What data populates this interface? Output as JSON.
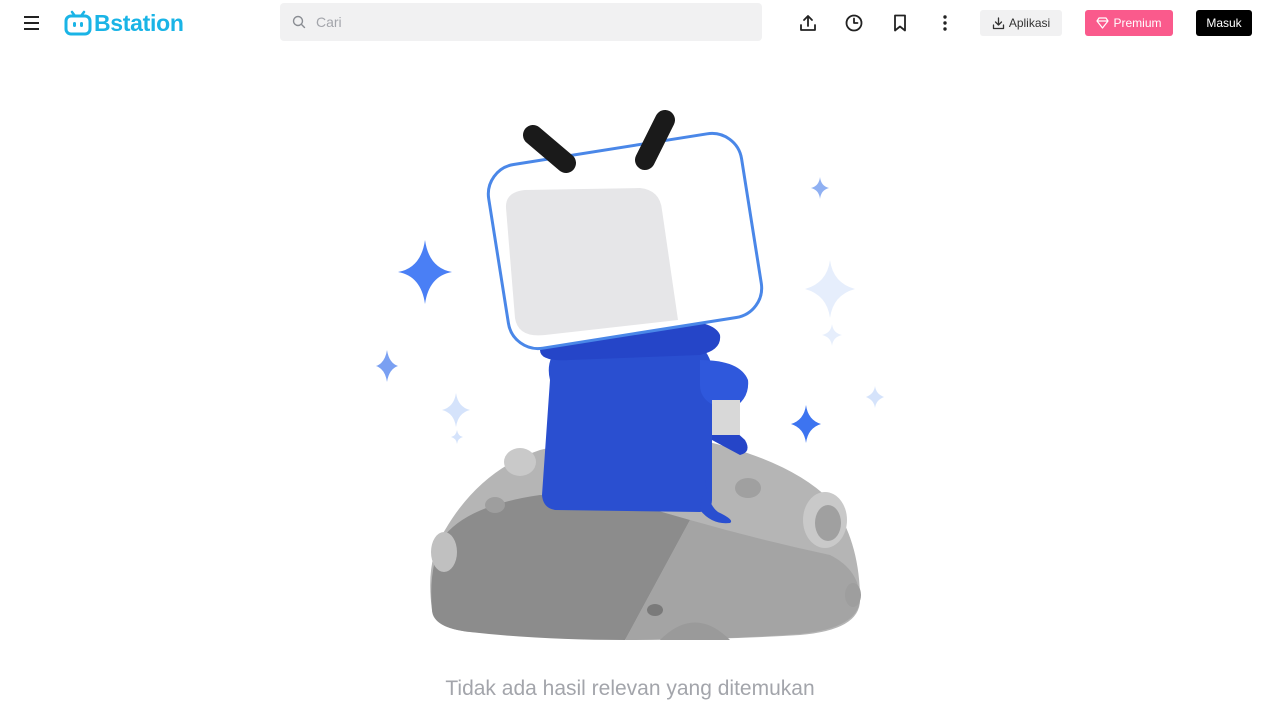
{
  "header": {
    "menu_icon": "hamburger-menu-icon",
    "logo_text": "Bstation",
    "search_placeholder": "Cari",
    "icons": [
      "upload-icon",
      "history-clock-icon",
      "bookmark-icon",
      "more-vertical-icon"
    ],
    "app_button_label": "Aplikasi",
    "premium_button_label": "Premium",
    "login_button_label": "Masuk"
  },
  "main": {
    "empty_message": "Tidak ada hasil relevan yang ditemukan"
  },
  "colors": {
    "brand": "#1ab4e6",
    "premium": "#fa5a8c",
    "login": "#000000",
    "mascot_blue": "#2a4fd0",
    "sparkle_blue": "#4a7ff5"
  }
}
